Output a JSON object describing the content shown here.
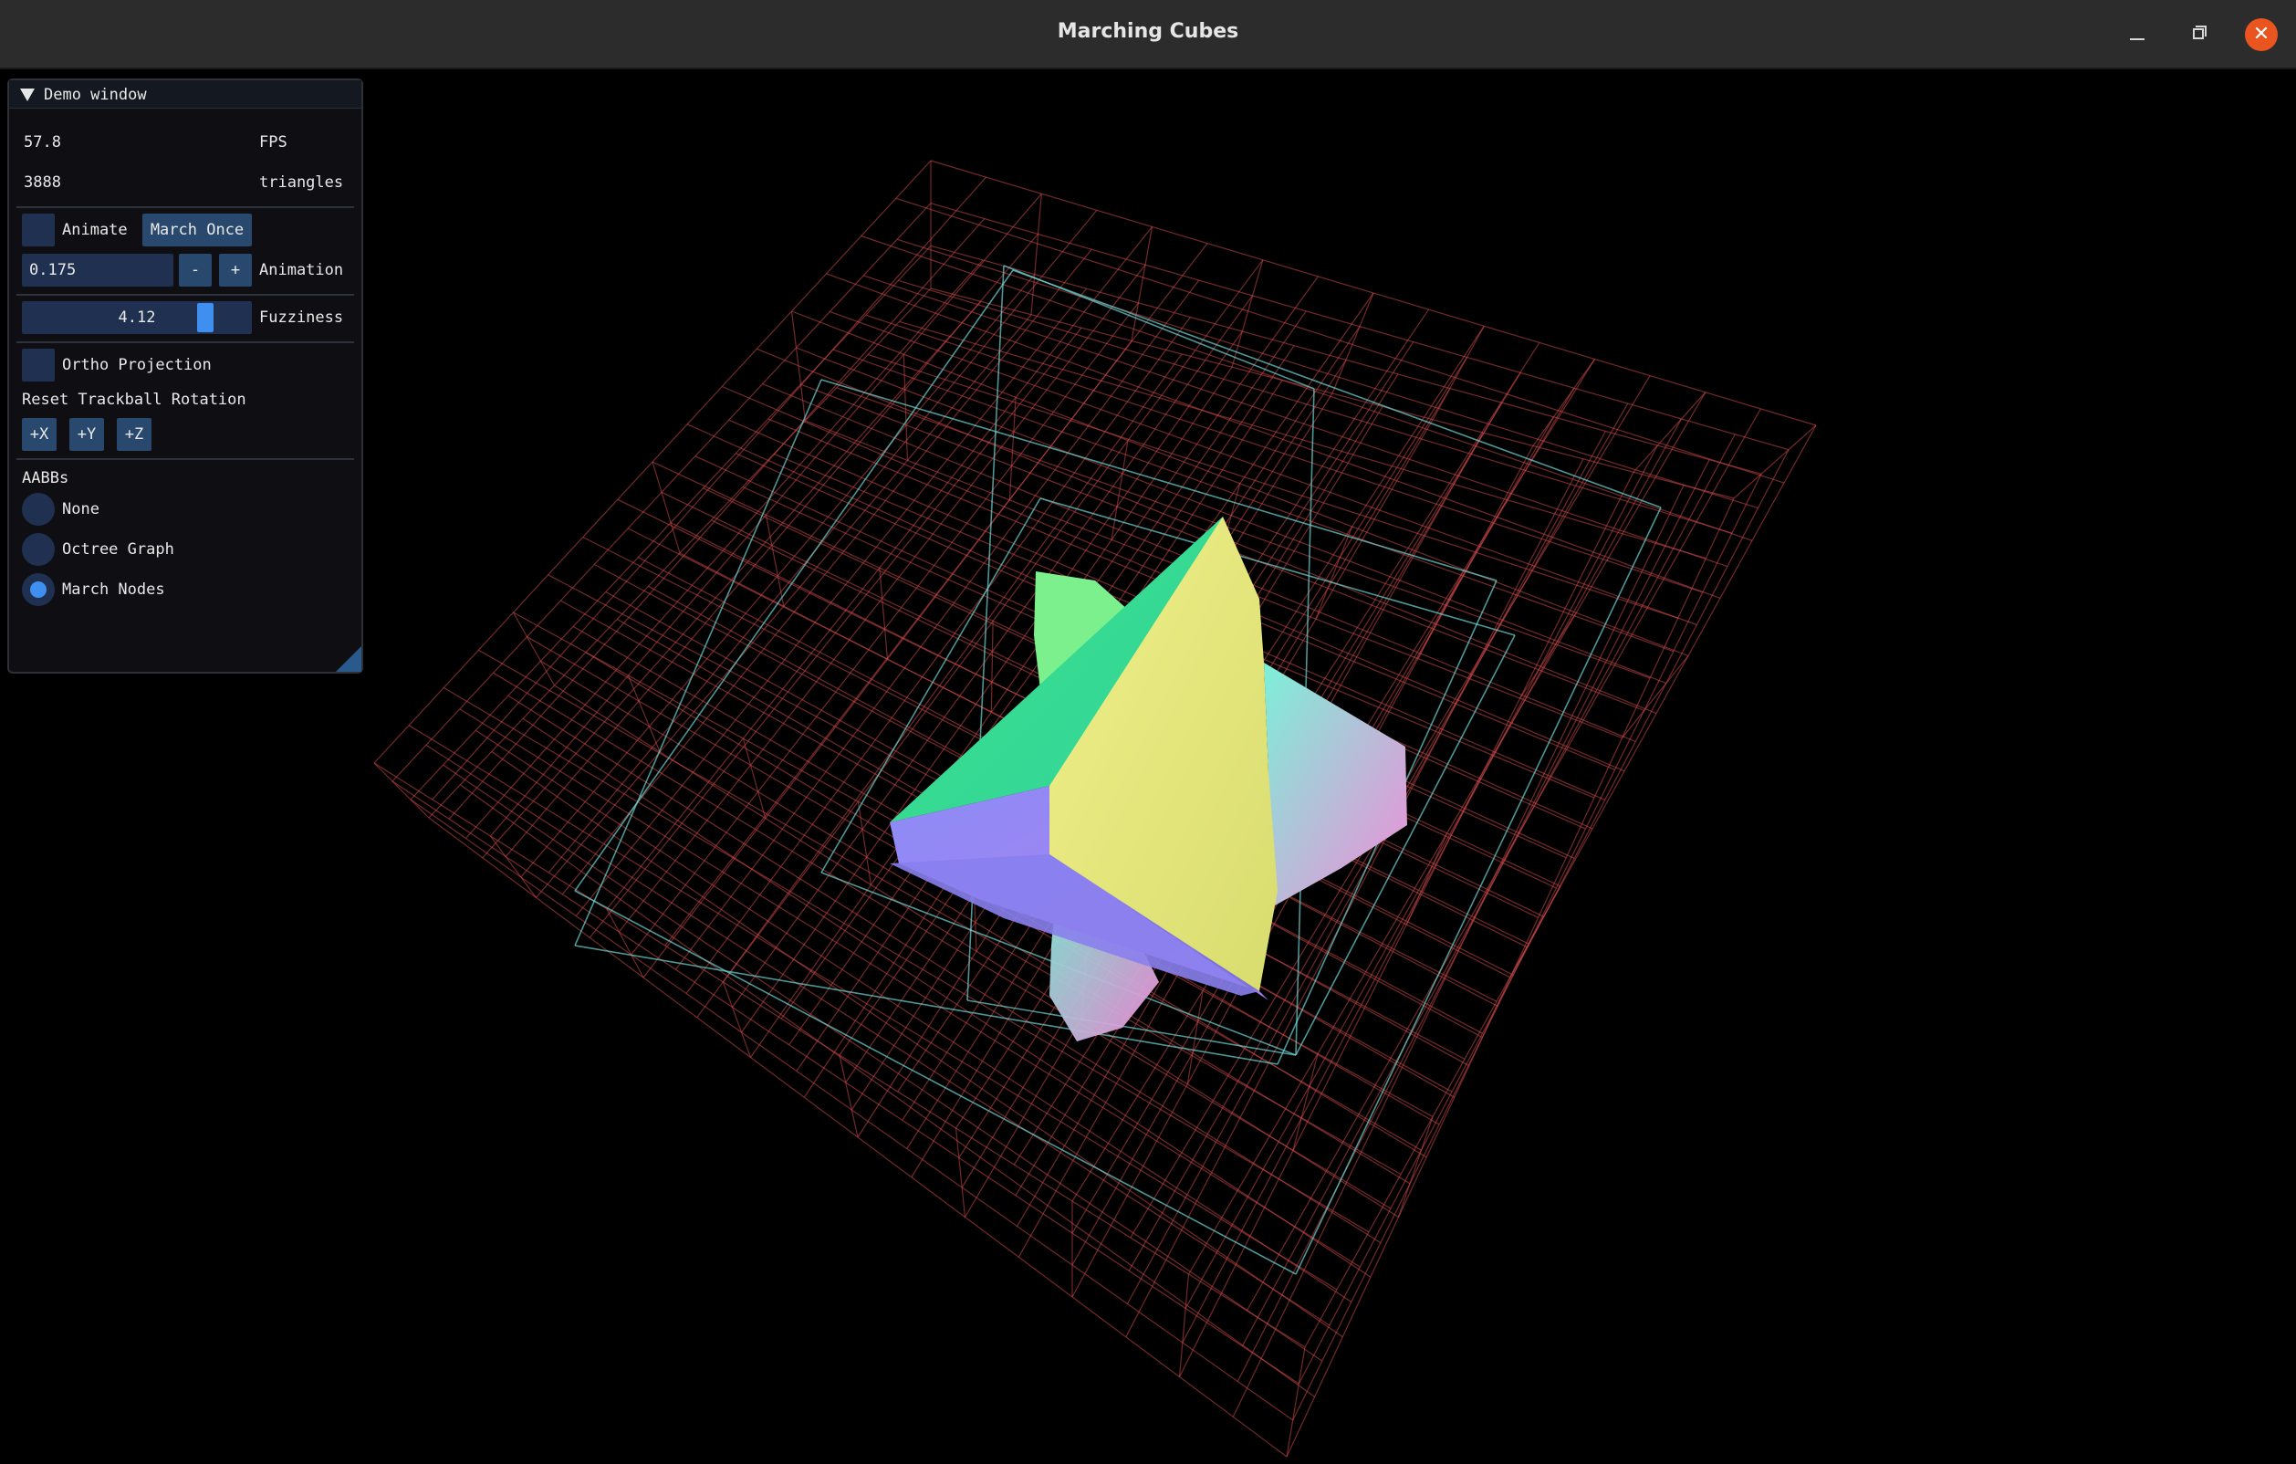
{
  "window": {
    "title": "Marching Cubes"
  },
  "panel": {
    "title": "Demo window",
    "fps_value": "57.8",
    "fps_label": "FPS",
    "triangles_value": "3888",
    "triangles_label": "triangles",
    "animate_label": "Animate",
    "march_once_label": "March Once",
    "animation_speed_value": "0.175",
    "minus_label": "-",
    "plus_label": "+",
    "animation_label": "Animation ",
    "fuzziness_value": "4.12",
    "fuzziness_fraction": 0.82,
    "fuzziness_label": "Fuzziness",
    "ortho_label": "Ortho Projection",
    "reset_label": "Reset Trackball Rotation",
    "axis_x": "+X",
    "axis_y": "+Y",
    "axis_z": "+Z",
    "aabbs_label": "AABBs",
    "radio_none": "None",
    "radio_octree": "Octree Graph",
    "radio_march": "March Nodes",
    "selected_radio": "March Nodes"
  },
  "colors": {
    "accent": "#3f8ff0",
    "button": "#28486e",
    "frame": "#203050",
    "close": "#e9541f",
    "grid_red": "#d24a4a",
    "grid_cyan": "#6fd6d6"
  },
  "icons": {
    "minimize": "minimize-icon",
    "maximize": "maximize-icon",
    "close": "close-icon",
    "collapse": "collapse-triangle-icon"
  }
}
